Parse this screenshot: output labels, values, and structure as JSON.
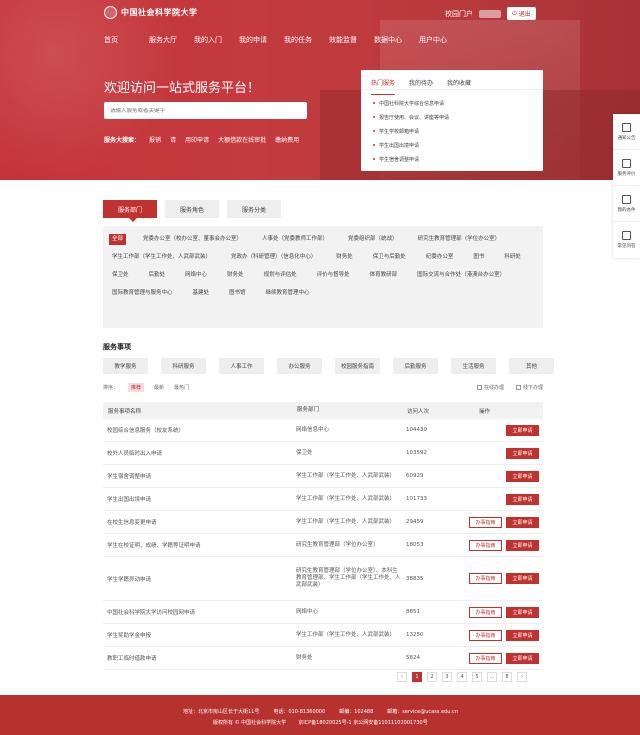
{
  "header": {
    "logo_text": "中国社会科学院大学",
    "user_name": "校园门户",
    "logout_label": "退出"
  },
  "nav": [
    "首页",
    "服务大厅",
    "我的入门",
    "我的申请",
    "我的任务",
    "效能监督",
    "数据中心",
    "用户中心"
  ],
  "hero": {
    "welcome": "欢迎访问一站式服务平台！",
    "search_placeholder": "请输入服务或者关键字",
    "hot_label": "服务大搜索：",
    "hot_items": [
      "报销",
      "请",
      "用印申请",
      "大额借款在线审批",
      "缴纳费用"
    ]
  },
  "panel": {
    "tabs": [
      "热门服务",
      "我的待办",
      "我的收藏"
    ],
    "items": [
      "中国社科院大学综合信息申请",
      "报告厅使用、会议、讲座等申请",
      "学生学校邮箱申请",
      "学生出国出境申请",
      "学生宿舍调整申请"
    ]
  },
  "side_float": [
    "通知公告",
    "服务评价",
    "我的办件",
    "常见问答"
  ],
  "category_tabs": [
    "服务部门",
    "服务角色",
    "服务分类"
  ],
  "departments": [
    "全部",
    "党委办公室（校办公室、董事会办公室）",
    "人事处（党委教师工作部）",
    "党委组织部（统战）",
    "研究生教育管理部（学位办公室）",
    "学生工作部（学生工作处、人武部武装）",
    "党政办（科研管理）（信息化中心）",
    "财务处",
    "保卫与后勤处",
    "纪委办公室",
    "图书",
    "科研处",
    "保卫处",
    "后勤处",
    "网络中心",
    "财务处",
    "规划与评估处",
    "评价与督导处",
    "体育教研部",
    "国际交流与合作处（港澳台办公室）",
    "国际教育管理与服务中心",
    "基建处",
    "图书馆",
    "继续教育管理中心"
  ],
  "services_title": "服务事项",
  "service_cats": [
    "教学服务",
    "科研服务",
    "人事工作",
    "办公服务",
    "校园服务指南",
    "后勤服务",
    "生活服务",
    "其他"
  ],
  "sort": {
    "label": "排序：",
    "options": [
      "推荐",
      "最新",
      "最热门"
    ],
    "filters": [
      "在线办理",
      "线下办理"
    ]
  },
  "table": {
    "headers": [
      "服务事项名称",
      "服务部门",
      "访问人次",
      "操作"
    ],
    "rows": [
      {
        "name": "校园综合信息服务（校友系统）",
        "dept": "网络信息中心",
        "visits": "104439",
        "actions": [
          "立即申请"
        ]
      },
      {
        "name": "校外人员临时出入申请",
        "dept": "保卫处",
        "visits": "103592",
        "actions": [
          "立即申请"
        ]
      },
      {
        "name": "学生宿舍调整申请",
        "dept": "学生工作部（学生工作处、人武部武装）",
        "visits": "60929",
        "actions": [
          "立即申请"
        ]
      },
      {
        "name": "学生出国出境申请",
        "dept": "学生工作部（学生工作处、人武部武装）",
        "visits": "101733",
        "actions": [
          "立即申请"
        ]
      },
      {
        "name": "在校生信息变更申请",
        "dept": "学生工作部（学生工作处、人武部武装）",
        "visits": "29459",
        "actions": [
          "办事指南",
          "立即申请"
        ]
      },
      {
        "name": "学生在校证明、成绩、学籍等证明申请",
        "dept": "研究生教育管理部（学位办公室）",
        "visits": "18053",
        "actions": [
          "办事指南",
          "立即申请"
        ]
      },
      {
        "name": "学生学籍异动申请",
        "dept": "研究生教育管理部（学位办公室）、本科生教育管理部、学生工作部（学生工作处、人武部武装）",
        "visits": "38835",
        "actions": [
          "办事指南",
          "立即申请"
        ]
      },
      {
        "name": "中国社会科学院大学访问校园网申请",
        "dept": "网络中心",
        "visits": "8851",
        "actions": [
          "办事指南",
          "立即申请"
        ]
      },
      {
        "name": "学生奖助学金申报",
        "dept": "学生工作部（学生工作处、人武部武装）",
        "visits": "13250",
        "actions": [
          "办事指南",
          "立即申请"
        ]
      },
      {
        "name": "教职工临时借款申请",
        "dept": "财务处",
        "visits": "5824",
        "actions": [
          "办事指南",
          "立即申请"
        ]
      }
    ]
  },
  "pagination": [
    "‹",
    "1",
    "2",
    "3",
    "4",
    "5",
    "…",
    "8",
    "›"
  ],
  "pagination_active": "1",
  "footer": {
    "address": "地址：北京市房山区长于大街11号",
    "phone": "电话：010-81360000",
    "postcode": "邮编：102488",
    "email": "邮箱：service@ucass.edu.cn",
    "copyright": "版权所有 © 中国社会科学院大学",
    "icp": "京ICP备18020025号-1  京公网安备11011102001730号"
  },
  "colors": {
    "primary": "#c0322f",
    "footer": "#b5322f"
  }
}
